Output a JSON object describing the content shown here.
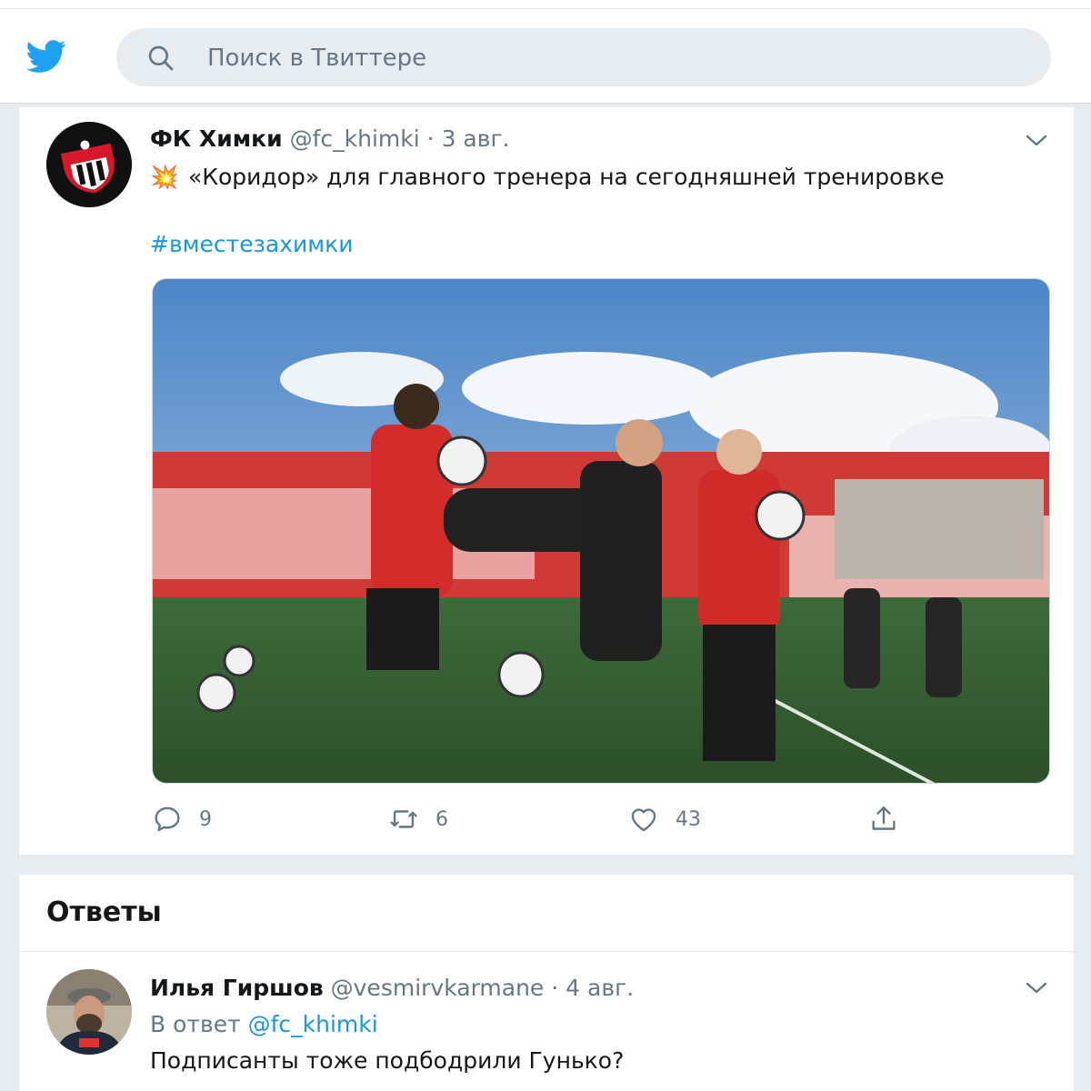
{
  "brand_color": "#1da1f2",
  "header": {
    "logo_icon": "twitter-bird-icon",
    "search_placeholder": "Поиск в Твиттере"
  },
  "tweet": {
    "author_name": "ФК Химки",
    "author_handle": "@fc_khimki",
    "separator": "·",
    "date": "3 авг.",
    "emoji": "💥",
    "text": "«Коридор» для главного тренера на сегодняшней тренировке",
    "hashtag": "#вместезахимки",
    "replies_count": "9",
    "retweets_count": "6",
    "likes_count": "43"
  },
  "replies": {
    "title": "Ответы",
    "items": [
      {
        "author_name": "Илья Гиршов",
        "author_handle": "@vesmirvkarmane",
        "separator": "·",
        "date": "4 авг.",
        "reply_to_label": "В ответ",
        "reply_to_handle": "@fc_khimki",
        "text": "Подписанты тоже подбодрили Гунько?"
      }
    ]
  }
}
